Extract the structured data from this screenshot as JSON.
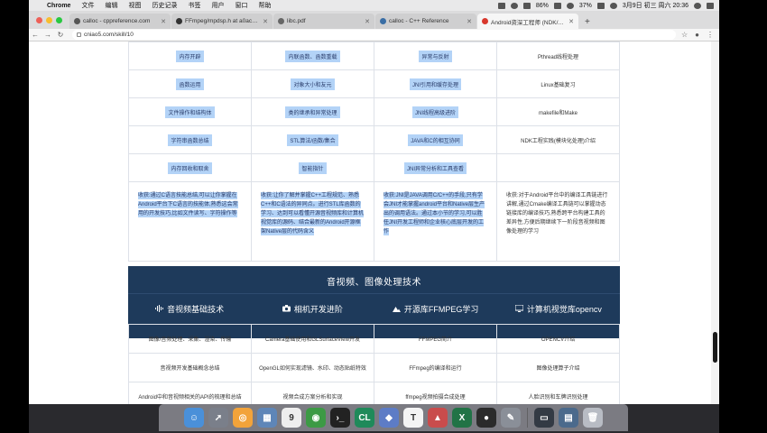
{
  "menubar": {
    "items": [
      {
        "label": "Chrome",
        "bold": true
      },
      {
        "label": "文件"
      },
      {
        "label": "编辑"
      },
      {
        "label": "视图"
      },
      {
        "label": "历史记录"
      },
      {
        "label": "书签"
      },
      {
        "label": "用户"
      },
      {
        "label": "窗口"
      },
      {
        "label": "帮助"
      }
    ],
    "battery": "86%",
    "percent2": "37%",
    "clock": "3月9日 初三 周六 20:36"
  },
  "tabs": [
    {
      "label": "calloc - cppreference.com",
      "color": "#555555"
    },
    {
      "label": "FFmpeg/mpdsp.h at a0ac49b",
      "color": "#333333"
    },
    {
      "label": "libc.pdf",
      "color": "#666666"
    },
    {
      "label": "calloc - C++ Reference",
      "color": "#3a6ea5"
    },
    {
      "label": "Android资深工程师 (NDK/音视…",
      "color": "#d8382d",
      "active": true
    }
  ],
  "toolbar": {
    "url": "cniao5.com/skill/10"
  },
  "top_table": {
    "rows": [
      [
        "内存开辟",
        "内联函数、函数重载",
        "异常与反射",
        "Pthread线程处理"
      ],
      [
        "函数运用",
        "对象大小和友元",
        "JNI引用和缓存处理",
        "Linux基础复习"
      ],
      [
        "文件操作和结构体",
        "类的继承和异常处理",
        "JNI线程高级进阶",
        "makefile和Make"
      ],
      [
        "字符串函数总结",
        "STL算法/函数/集合",
        "JAVA和C的相互协同",
        "NDK工程实践(模块化处理)介绍"
      ],
      [
        "内存回收和取舍",
        "智能指针",
        "JNI异常分析和工具查看",
        ""
      ]
    ],
    "descriptions": [
      "收获:通过C语言技能总结,可以让你掌握在Android平台下C语言的技能体,熟悉这会常用的开发技巧,比如文件读写、字符操作等",
      "收获:让你了解并掌握C++工程规范、熟悉C++和C语法的异同点。进行STL库函数的学习、达到可以看懂开源音视频库和计算机视觉库的源码、结合最新的Android开源框架Native层的代码含义",
      "收获:JNI是JAVA调用C/C++的手段,只有学会JNI才能掌握android平台和Native层生产出的调用语法。通过本小节的学习,可以胜任JNI开发工程师和企业核心底层开发的工作",
      "收获:对于Android平台中的编译工具链进行讲解,通过Cmake编译工具链可以掌握动态链接库的编译技巧,熟悉跨平台构建工具的差异性,方便后期继续下一阶段音视频和图像处理的学习"
    ]
  },
  "section": {
    "title": "音视频、图像处理技术",
    "columns": [
      {
        "label": "音视频基础技术",
        "icon": "audio-wave-icon"
      },
      {
        "label": "相机开发进阶",
        "icon": "camera-icon"
      },
      {
        "label": "开源库FFMPEG学习",
        "icon": "mountain-image-icon"
      },
      {
        "label": "计算机视觉库opencv",
        "icon": "monitor-icon"
      }
    ]
  },
  "bottom_table": {
    "rows": [
      [
        "图像/音频处理、采集、渲染、传输",
        "Camera基础使用和GLSurfaceView开发",
        "FFMPEG简介",
        "OPENCV介绍"
      ],
      [
        "音视频开发基础概念总结",
        "OpenGL如何实现滤镜、水印、动态贴纸特效",
        "FFmpeg的编译和运行",
        "图像处理算子介绍"
      ],
      [
        "Android中和音视频相关的API的梳理和总结",
        "视频合成方案分析和实现",
        "ffmpeg视频拍摄合成处理",
        "人脸识别和车牌识别处理"
      ]
    ]
  },
  "dock": {
    "apps": [
      {
        "name": "finder-icon",
        "color": "#4a90d9",
        "glyph": "☺"
      },
      {
        "name": "launchpad-icon",
        "color": "#7a7f8a",
        "glyph": "➚"
      },
      {
        "name": "safari-icon",
        "color": "#f2a33a",
        "glyph": "◎"
      },
      {
        "name": "preview-icon",
        "color": "#5e86b8",
        "glyph": "▦"
      },
      {
        "name": "calendar-icon",
        "color": "#eeeeee",
        "glyph": "9"
      },
      {
        "name": "chrome-icon",
        "color": "#3c9a45",
        "glyph": "◉"
      },
      {
        "name": "terminal-icon",
        "color": "#222222",
        "glyph": "›_"
      },
      {
        "name": "clion-icon",
        "color": "#1f8a5a",
        "glyph": "CL"
      },
      {
        "name": "xcode-icon",
        "color": "#5d7cc6",
        "glyph": "◆"
      },
      {
        "name": "typora-icon",
        "color": "#f4f4f4",
        "glyph": "T"
      },
      {
        "name": "mail-icon",
        "color": "#c94c4c",
        "glyph": "▲"
      },
      {
        "name": "excel-icon",
        "color": "#217346",
        "glyph": "X"
      },
      {
        "name": "obs-icon",
        "color": "#2b2b2b",
        "glyph": "●"
      },
      {
        "name": "utility-icon",
        "color": "#8a8f98",
        "glyph": "✎"
      }
    ],
    "right": [
      {
        "name": "screen-recording-icon",
        "color": "#333a44",
        "glyph": "▭"
      },
      {
        "name": "downloads-icon",
        "color": "#4b6a8c",
        "glyph": "▤"
      },
      {
        "name": "trash-icon",
        "color": "#b8bcc4",
        "glyph": "🗑"
      }
    ]
  }
}
